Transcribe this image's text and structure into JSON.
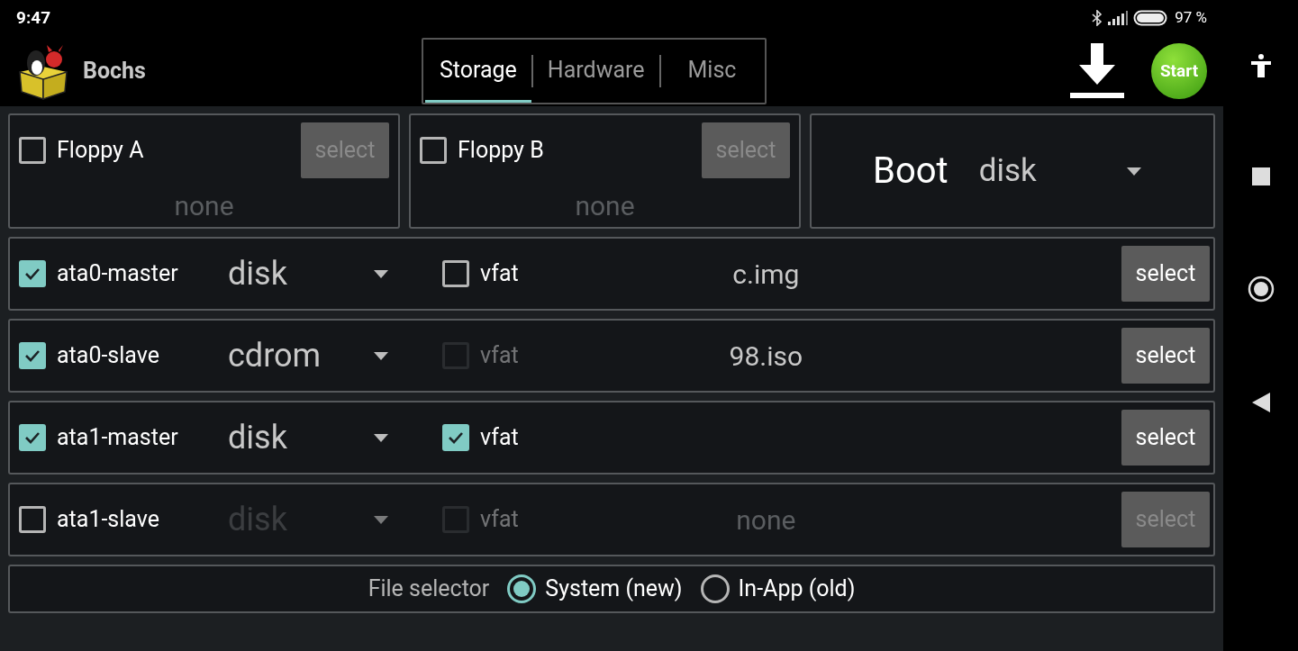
{
  "status_bar": {
    "time": "9:47",
    "battery": "97 %"
  },
  "app": {
    "title": "Bochs"
  },
  "tabs": [
    {
      "label": "Storage",
      "selected": true
    },
    {
      "label": "Hardware",
      "selected": false
    },
    {
      "label": "Misc",
      "selected": false
    }
  ],
  "start_button": "Start",
  "floppies": [
    {
      "label": "Floppy A",
      "checked": false,
      "image": "none",
      "button": "select",
      "button_disabled": true
    },
    {
      "label": "Floppy B",
      "checked": false,
      "image": "none",
      "button": "select",
      "button_disabled": true
    }
  ],
  "boot": {
    "label": "Boot",
    "value": "disk"
  },
  "drives": [
    {
      "label": "ata0-master",
      "checked": true,
      "type": "disk",
      "type_disabled": false,
      "vfat": {
        "label": "vfat",
        "checked": false,
        "disabled": false
      },
      "image": "c.img",
      "image_disabled": false,
      "button": "select",
      "button_disabled": false
    },
    {
      "label": "ata0-slave",
      "checked": true,
      "type": "cdrom",
      "type_disabled": false,
      "vfat": {
        "label": "vfat",
        "checked": false,
        "disabled": true
      },
      "image": "98.iso",
      "image_disabled": false,
      "button": "select",
      "button_disabled": false
    },
    {
      "label": "ata1-master",
      "checked": true,
      "type": "disk",
      "type_disabled": false,
      "vfat": {
        "label": "vfat",
        "checked": true,
        "disabled": false
      },
      "button": "select",
      "button_disabled": false
    },
    {
      "label": "ata1-slave",
      "checked": false,
      "type": "disk",
      "type_disabled": true,
      "vfat": {
        "label": "vfat",
        "checked": false,
        "disabled": true
      },
      "image": "none",
      "image_disabled": true,
      "button": "select",
      "button_disabled": true
    }
  ],
  "file_selector": {
    "label": "File selector",
    "options": [
      {
        "label": "System (new)",
        "selected": true
      },
      {
        "label": "In-App (old)",
        "selected": false
      }
    ]
  }
}
